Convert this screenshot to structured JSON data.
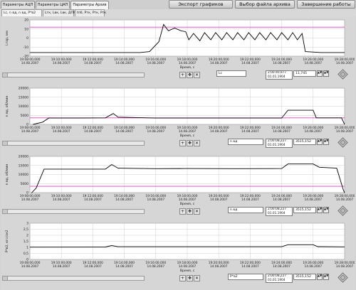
{
  "tabs": [
    {
      "label": "Параметры АЦП",
      "active": false
    },
    {
      "label": "Параметры ЦАП",
      "active": false
    },
    {
      "label": "Параметры Архив",
      "active": true
    }
  ],
  "buttons": {
    "export": "Экспорт графиков",
    "select_file": "Выбор файла архива",
    "finish": "Завершение работы"
  },
  "subtabs": [
    {
      "label": "Lc, n вд, n вд, P*в2",
      "active": true
    },
    {
      "label": "Lтк, Lвк, Lвк, ДПМ",
      "active": false
    },
    {
      "label": "tпб, Ртк, Ртк, Ртк",
      "active": false
    }
  ],
  "x_ticks": [
    {
      "t": "19:08:00,000",
      "d": "14.08.2007"
    },
    {
      "t": "19:10:00,000",
      "d": "14.08.2007"
    },
    {
      "t": "19:12:00,000",
      "d": "14.08.2007"
    },
    {
      "t": "19:14:00,000",
      "d": "14.08.2007"
    },
    {
      "t": "19:16:00,000",
      "d": "14.08.2007"
    },
    {
      "t": "19:18:00,000",
      "d": "14.08.2007"
    },
    {
      "t": "19:20:00,000",
      "d": "14.08.2007"
    },
    {
      "t": "19:22:00,000",
      "d": "14.08.2007"
    },
    {
      "t": "19:24:00,000",
      "d": "14.08.2007"
    },
    {
      "t": "19:26:00,000",
      "d": "14.08.2007"
    },
    {
      "t": "19:28:00,000",
      "d": "14.08.2007"
    }
  ],
  "x_axis_label": "Время, с",
  "colors": {
    "trace": "#000000",
    "threshold": "#e040c0",
    "grid": "#cfcfcf",
    "plot_bg": "#ffffff"
  },
  "chart_data": [
    {
      "type": "line",
      "ylabel": "Lтор, мм",
      "y_ticks": [
        "20",
        "10",
        "0",
        "-10",
        "-20"
      ],
      "ylim": [
        -20,
        20
      ],
      "threshold": 12,
      "x_unit": "minutes from 19:08",
      "series": [
        {
          "points": [
            [
              0,
              -16
            ],
            [
              3,
              -16
            ],
            [
              5,
              -16
            ],
            [
              7,
              -16
            ],
            [
              7.6,
              -15
            ],
            [
              8.2,
              -4
            ],
            [
              8.5,
              15
            ],
            [
              8.8,
              8
            ],
            [
              9.2,
              11
            ],
            [
              9.6,
              8
            ],
            [
              9.9,
              7
            ],
            [
              10.1,
              -2
            ],
            [
              10.4,
              5
            ],
            [
              10.8,
              -3
            ],
            [
              11.1,
              6
            ],
            [
              11.5,
              -2
            ],
            [
              11.8,
              6
            ],
            [
              12.2,
              -2
            ],
            [
              12.5,
              6
            ],
            [
              12.9,
              -2
            ],
            [
              13.2,
              6
            ],
            [
              13.6,
              -2
            ],
            [
              13.9,
              6
            ],
            [
              14.3,
              -2
            ],
            [
              14.6,
              6
            ],
            [
              15,
              -2
            ],
            [
              15.3,
              6
            ],
            [
              15.7,
              -2
            ],
            [
              16,
              6
            ],
            [
              16.4,
              -2
            ],
            [
              16.7,
              6
            ],
            [
              17,
              -2
            ],
            [
              17.3,
              5
            ],
            [
              17.5,
              -15
            ],
            [
              18.5,
              -16
            ],
            [
              20,
              -16
            ]
          ]
        }
      ],
      "readout_name": "Lc",
      "readout_time": "2:00:40,977",
      "readout_date": "01.01.1904",
      "readout_value": "11,745"
    },
    {
      "type": "line",
      "ylabel": "n вд, об/мин",
      "y_ticks": [
        "20000",
        "15000",
        "10000",
        "5000",
        "0"
      ],
      "ylim": [
        0,
        20000
      ],
      "threshold": 3600,
      "x_unit": "minutes from 19:08",
      "series": [
        {
          "points": [
            [
              0.2,
              0
            ],
            [
              0.8,
              1200
            ],
            [
              1.2,
              3500
            ],
            [
              3,
              3500
            ],
            [
              4.8,
              3600
            ],
            [
              5.3,
              6000
            ],
            [
              5.6,
              4000
            ],
            [
              8,
              3500
            ],
            [
              10,
              3500
            ],
            [
              13,
              3500
            ],
            [
              16,
              3500
            ],
            [
              16.4,
              7800
            ],
            [
              18,
              7800
            ],
            [
              18.2,
              3600
            ],
            [
              19.8,
              3600
            ],
            [
              20,
              0
            ]
          ]
        }
      ],
      "readout_name": "n вд",
      "readout_time": "2:00:08,227",
      "readout_date": "01.01.1904",
      "readout_value": "3515,152"
    },
    {
      "type": "line",
      "ylabel": "n вд, об/мин",
      "y_ticks": [
        "20000",
        "15000",
        "10000",
        "5000",
        "0"
      ],
      "ylim": [
        0,
        20000
      ],
      "threshold": 3500,
      "x_unit": "minutes from 19:08",
      "series": [
        {
          "points": [
            [
              0.1,
              -200
            ],
            [
              0.4,
              2500
            ],
            [
              0.9,
              13000
            ],
            [
              3,
              13000
            ],
            [
              4.8,
              13000
            ],
            [
              5.2,
              15500
            ],
            [
              5.6,
              13500
            ],
            [
              8,
              13200
            ],
            [
              10,
              13300
            ],
            [
              13,
              13200
            ],
            [
              16,
              13300
            ],
            [
              16.4,
              15800
            ],
            [
              18,
              15800
            ],
            [
              18.4,
              14000
            ],
            [
              19.5,
              13500
            ],
            [
              19.9,
              2000
            ],
            [
              20,
              -200
            ]
          ]
        }
      ],
      "readout_name": "n вд",
      "readout_time": "2:00:08,227",
      "readout_date": "01.01.1904",
      "readout_value": "3515,152"
    },
    {
      "type": "line",
      "ylabel": "P*в2, кгс/см2",
      "y_ticks": [
        "3",
        "2,5",
        "2",
        "1,5",
        "1",
        "0,5",
        "0"
      ],
      "ylim": [
        0,
        3
      ],
      "threshold": null,
      "x_unit": "minutes from 19:08",
      "series": [
        {
          "points": [
            [
              0,
              1.02
            ],
            [
              4.8,
              1.03
            ],
            [
              5.2,
              1.15
            ],
            [
              5.6,
              1.05
            ],
            [
              16,
              1.05
            ],
            [
              16.4,
              1.22
            ],
            [
              18,
              1.22
            ],
            [
              18.3,
              1.06
            ],
            [
              20,
              1.04
            ]
          ]
        }
      ],
      "readout_name": "P*в2",
      "readout_time": "2:00:08,227",
      "readout_date": "01.01.1904",
      "readout_value": "3515,152"
    }
  ]
}
